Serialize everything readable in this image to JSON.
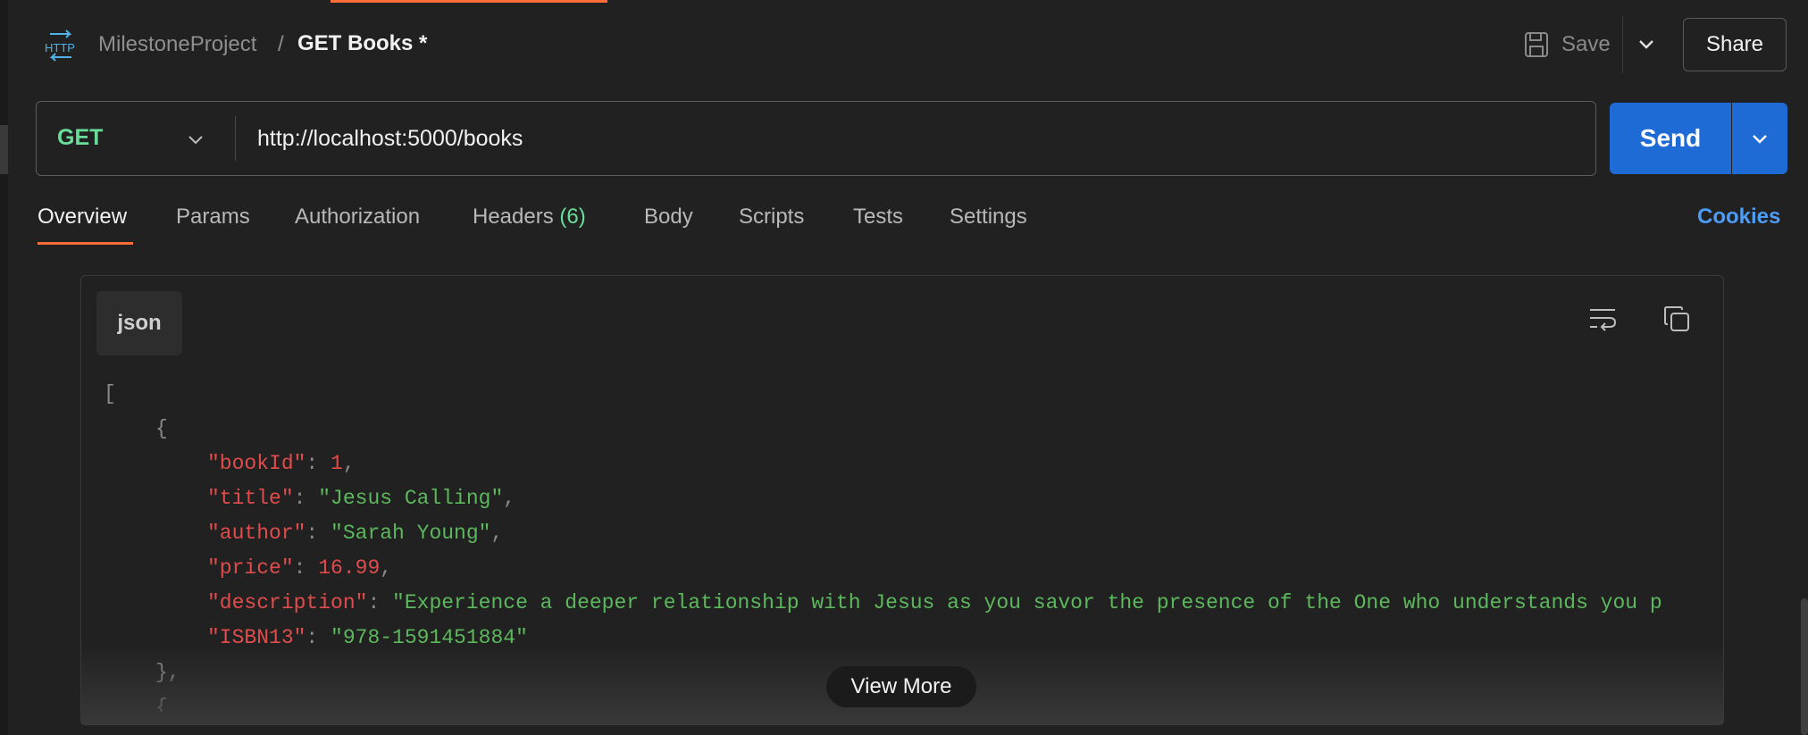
{
  "header": {
    "collection": "MilestoneProject",
    "separator": "/",
    "request_name": "GET Books *",
    "save_label": "Save",
    "share_label": "Share"
  },
  "request": {
    "method": "GET",
    "url": "http://localhost:5000/books",
    "send_label": "Send"
  },
  "tabs": [
    {
      "label": "Overview",
      "active": true
    },
    {
      "label": "Params"
    },
    {
      "label": "Authorization"
    },
    {
      "label": "Headers",
      "count": "(6)"
    },
    {
      "label": "Body"
    },
    {
      "label": "Scripts"
    },
    {
      "label": "Tests"
    },
    {
      "label": "Settings"
    }
  ],
  "cookies_label": "Cookies",
  "response": {
    "language": "json",
    "lines": {
      "l1": "[",
      "l2": "{",
      "k1": "\"bookId\"",
      "v1": "1",
      "k2": "\"title\"",
      "v2": "\"Jesus Calling\"",
      "k3": "\"author\"",
      "v3": "\"Sarah Young\"",
      "k4": "\"price\"",
      "v4": "16.99",
      "k5": "\"description\"",
      "v5": "\"Experience a deeper relationship with Jesus as you savor the presence of the One who understands you p",
      "k6": "\"ISBN13\"",
      "v6": "\"978-1591451884\"",
      "l9": "},",
      "l10": "{"
    },
    "view_more_label": "View More"
  },
  "colors": {
    "accent": "#ff6c37",
    "send": "#1f6bd6",
    "method": "#6bdd9a",
    "json_key": "#e04c4c",
    "json_string": "#5cb85c",
    "link": "#4d9df7"
  }
}
